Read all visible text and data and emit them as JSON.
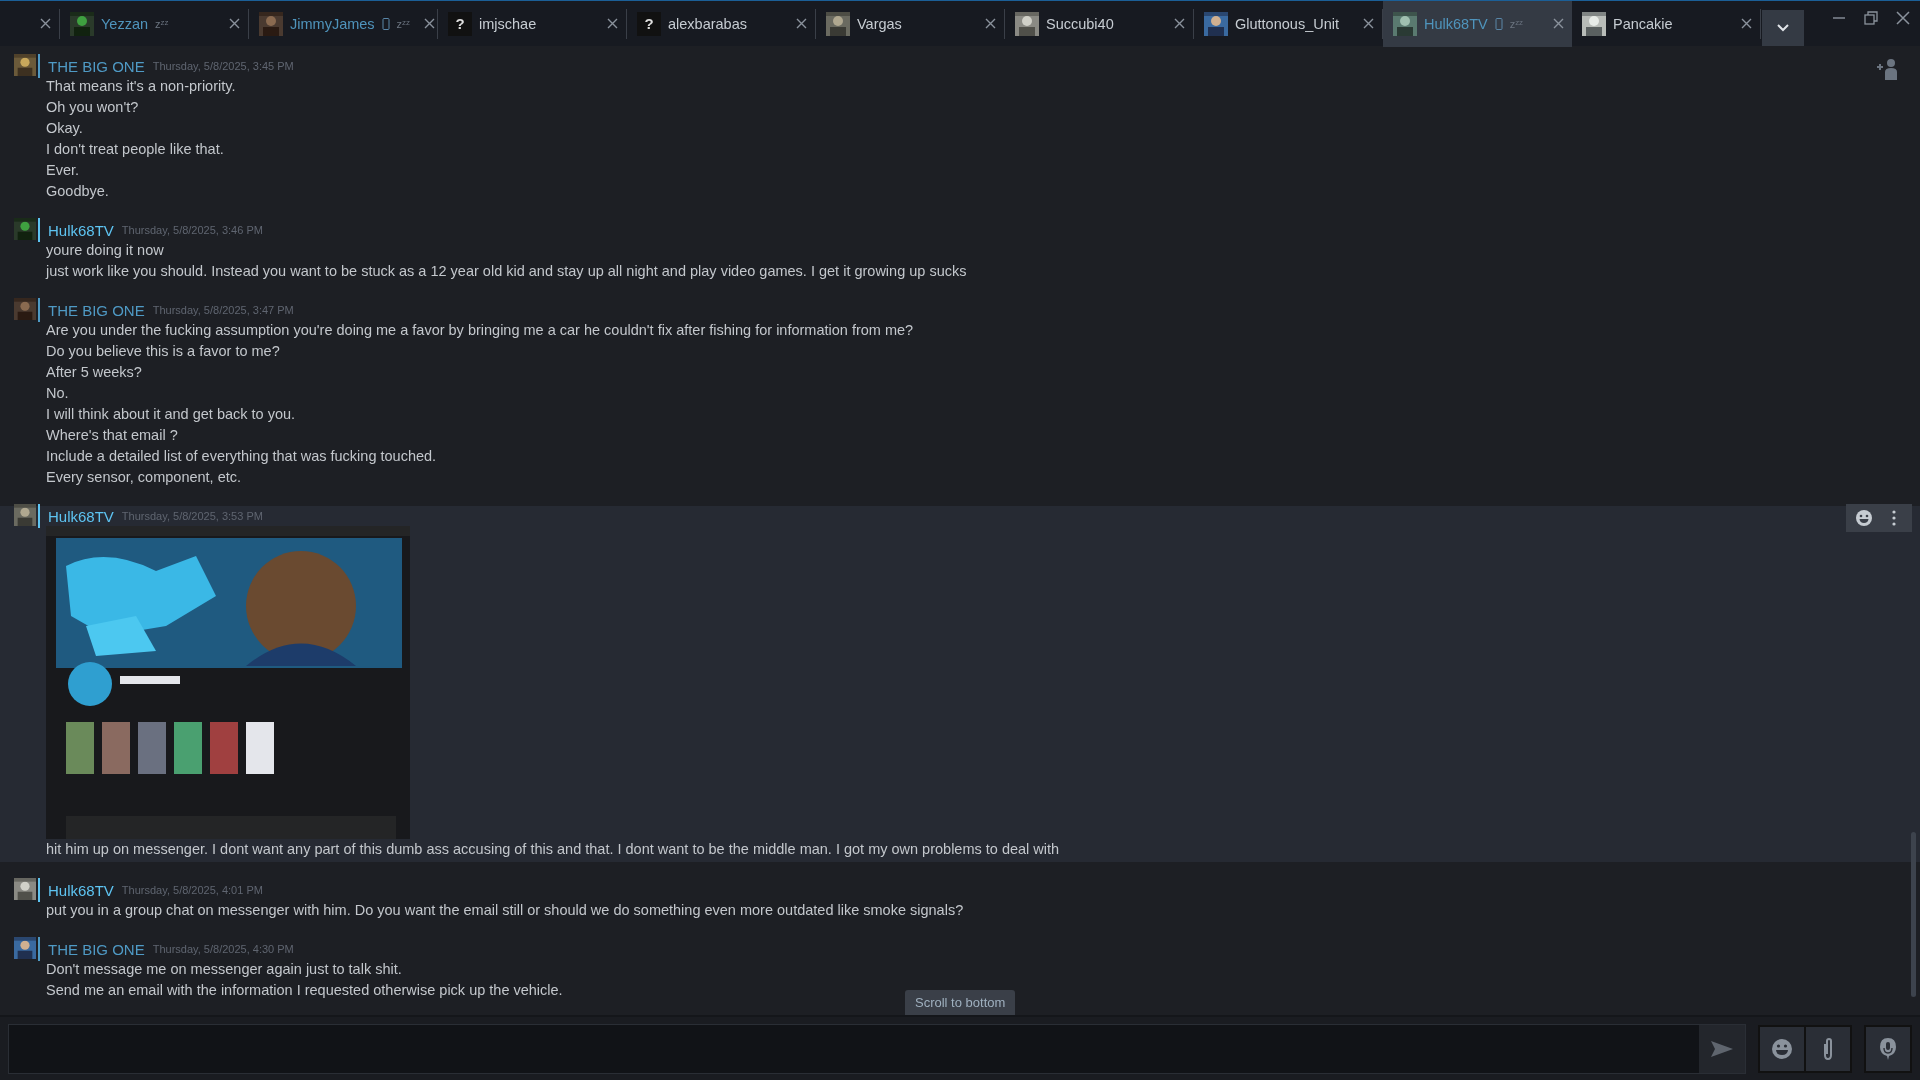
{
  "tabs": [
    {
      "kind": "cut",
      "selected": false
    },
    {
      "kind": "friend",
      "name": "Yezzan",
      "color": "#4f94bc",
      "status_mark": "zᶻᶻ",
      "mobile": false,
      "selected": false
    },
    {
      "kind": "friend",
      "name": "JimmyJames",
      "color": "#4f94bc",
      "status_mark": "zᶻᶻ",
      "mobile": true,
      "selected": false
    },
    {
      "kind": "friend",
      "name": "imjschae",
      "color": "#c6ccd2",
      "avatar_glyph": "?",
      "mobile": false,
      "selected": false
    },
    {
      "kind": "friend",
      "name": "alexbarabas",
      "color": "#c6ccd2",
      "avatar_glyph": "?",
      "mobile": false,
      "selected": false
    },
    {
      "kind": "friend",
      "name": "Vargas",
      "color": "#c6ccd2",
      "mobile": false,
      "selected": false
    },
    {
      "kind": "friend",
      "name": "Succubi40",
      "color": "#c6ccd2",
      "mobile": false,
      "selected": false
    },
    {
      "kind": "friend",
      "name": "Gluttonous_Unit",
      "color": "#c6ccd2",
      "mobile": false,
      "selected": false
    },
    {
      "kind": "friend",
      "name": "Hulk68TV",
      "color": "#4f94bc",
      "status_mark": "zᶻᶻ",
      "mobile": true,
      "selected": true
    },
    {
      "kind": "friend",
      "name": "Pancakie",
      "color": "#c6ccd2",
      "mobile": false,
      "selected": false
    }
  ],
  "messages": [
    {
      "author": "THE BIG ONE",
      "color": "#4f9ac5",
      "time": "Thursday, 5/8/2025, 3:45 PM",
      "hovered": false,
      "items": [
        {
          "kind": "text",
          "text": "That means it's a non-priority."
        },
        {
          "kind": "text",
          "text": "Oh you won't?"
        },
        {
          "kind": "text",
          "text": "Okay."
        },
        {
          "kind": "text",
          "text": "I don't treat people like that."
        },
        {
          "kind": "text",
          "text": "Ever."
        },
        {
          "kind": "text",
          "text": "Goodbye."
        }
      ]
    },
    {
      "author": "Hulk68TV",
      "color": "#5ec4f2",
      "time": "Thursday, 5/8/2025, 3:46 PM",
      "hovered": false,
      "items": [
        {
          "kind": "text",
          "text": "youre doing it now"
        },
        {
          "kind": "text",
          "text": "just work like you should. Instead you want to be stuck as a 12 year old kid and stay up all night and play video games. I get it growing up sucks"
        }
      ]
    },
    {
      "author": "THE BIG ONE",
      "color": "#4f9ac5",
      "time": "Thursday, 5/8/2025, 3:47 PM",
      "hovered": false,
      "items": [
        {
          "kind": "text",
          "text": "Are you under the fucking assumption you're doing me a favor by bringing me a car he couldn't fix after fishing for information from me?"
        },
        {
          "kind": "text",
          "text": "Do you believe this is a favor to me?"
        },
        {
          "kind": "text",
          "text": "After 5 weeks?"
        },
        {
          "kind": "text",
          "text": "No."
        },
        {
          "kind": "text",
          "text": "I will think about it and get back to you."
        },
        {
          "kind": "text",
          "text": "Where's that email ?"
        },
        {
          "kind": "text",
          "text": "Include a detailed list of everything that was fucking touched."
        },
        {
          "kind": "text",
          "text": "Every sensor, component, etc."
        }
      ]
    },
    {
      "author": "Hulk68TV",
      "color": "#5ec4f2",
      "time": "Thursday, 5/8/2025, 3:53 PM",
      "hovered": true,
      "items": [
        {
          "kind": "picture"
        },
        {
          "kind": "text",
          "text": "hit him up on messenger. I dont want any part of this dumb ass accusing of this and that. I dont want to be the middle man. I got my own problems to deal with"
        }
      ]
    },
    {
      "author": "Hulk68TV",
      "color": "#5ec4f2",
      "time": "Thursday, 5/8/2025, 4:01 PM",
      "hovered": false,
      "items": [
        {
          "kind": "text",
          "text": "put you in a group chat on messenger with him. Do you want the email still or should we do something even more outdated like smoke signals?"
        }
      ]
    },
    {
      "author": "THE BIG ONE",
      "color": "#4f9ac5",
      "time": "Thursday, 5/8/2025, 4:30 PM",
      "hovered": false,
      "items": [
        {
          "kind": "text",
          "text": "Don't message me on messenger again just to talk shit."
        },
        {
          "kind": "text",
          "text": "Send me an email with the information I requested otherwise pick up the vehicle."
        }
      ]
    }
  ],
  "scroll_button": "Scroll to bottom"
}
